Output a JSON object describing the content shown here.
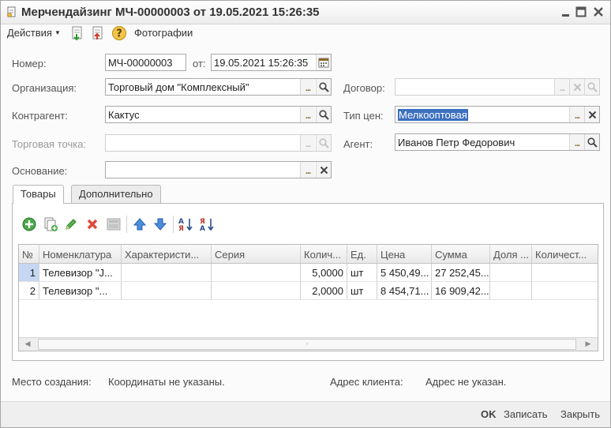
{
  "window": {
    "title": "Мерчендайзинг МЧ-00000003 от 19.05.2021 15:26:35"
  },
  "toolbar": {
    "actions_label": "Действия",
    "photos_label": "Фотографии"
  },
  "form": {
    "number_label": "Номер:",
    "number_value": "МЧ-00000003",
    "date_label": "от:",
    "date_value": "19.05.2021 15:26:35",
    "organization_label": "Организация:",
    "organization_value": "Торговый дом \"Комплексный\"",
    "counterparty_label": "Контрагент:",
    "counterparty_value": "Кактус",
    "outlet_label": "Торговая точка:",
    "outlet_value": "",
    "basis_label": "Основание:",
    "basis_value": "",
    "contract_label": "Договор:",
    "contract_value": "",
    "price_type_label": "Тип цен:",
    "price_type_value": "Мелкооптовая",
    "agent_label": "Агент:",
    "agent_value": "Иванов Петр Федорович"
  },
  "tabs": [
    {
      "label": "Товары",
      "active": true
    },
    {
      "label": "Дополнительно",
      "active": false
    }
  ],
  "grid": {
    "columns": [
      "№",
      "Номенклатура",
      "Характеристи...",
      "Серия",
      "Колич...",
      "Ед.",
      "Цена",
      "Сумма",
      "Доля ...",
      "Количест..."
    ],
    "rows": [
      {
        "no": "1",
        "item": "Телевизор \"J...",
        "characteristic": "",
        "series": "",
        "qty": "5,0000",
        "unit": "шт",
        "price": "5 450,49...",
        "sum": "27 252,45...",
        "share": "",
        "qty2": ""
      },
      {
        "no": "2",
        "item": "Телевизор \"...",
        "characteristic": "",
        "series": "",
        "qty": "2,0000",
        "unit": "шт",
        "price": "8 454,71...",
        "sum": "16 909,42...",
        "share": "",
        "qty2": ""
      }
    ]
  },
  "footer": {
    "creation_place_label": "Место создания:",
    "creation_place_value": "Координаты не указаны.",
    "client_address_label": "Адрес клиента:",
    "client_address_value": "Адрес не указан."
  },
  "buttons": {
    "ok": "OK",
    "save": "Записать",
    "close": "Закрыть"
  },
  "colors": {
    "selection": "#3c6fbf",
    "selected_row": "#c5d7f2"
  }
}
